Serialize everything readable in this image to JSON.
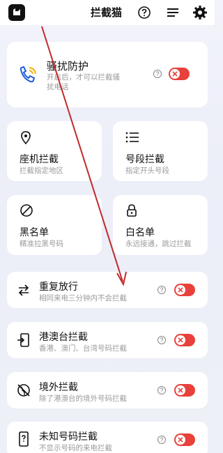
{
  "header": {
    "title": "拦截猫"
  },
  "guard": {
    "title": "骚扰防护",
    "subtitle_line1": "开启后，才可以拦截骚",
    "subtitle_line2": "扰电话",
    "help": "?"
  },
  "grid": [
    {
      "title": "座机拦截",
      "subtitle": "拦截指定地区"
    },
    {
      "title": "号段拦截",
      "subtitle": "指定开头号段"
    },
    {
      "title": "黑名单",
      "subtitle": "精准拉黑号码"
    },
    {
      "title": "白名单",
      "subtitle": "永远接通，跳过拦截"
    }
  ],
  "rows": [
    {
      "title": "重复放行",
      "subtitle": "相同来电三分钟内不会拦截",
      "help": "?"
    },
    {
      "title": "港澳台拦截",
      "subtitle": "香港、澳门、台湾号码拦截",
      "help": "?"
    },
    {
      "title": "境外拦截",
      "subtitle": "除了港澳台的境外号码拦截",
      "help": "?"
    },
    {
      "title": "未知号码拦截",
      "subtitle": "不显示号码的来电拦截",
      "help": "?"
    }
  ],
  "colors": {
    "accent": "#e8413b",
    "background": "#eef0f7",
    "card": "#ffffff",
    "guard_icon_blue": "#1f5fd6",
    "guard_icon_yellow": "#f5b400",
    "arrow": "#c22a2a"
  },
  "icons": [
    "app-logo",
    "help-circle",
    "menu-lines",
    "gear",
    "phone-waves",
    "location-pin",
    "list",
    "ban",
    "lock",
    "repeat-arrows",
    "phone-exit",
    "globe-off",
    "phone-question"
  ]
}
